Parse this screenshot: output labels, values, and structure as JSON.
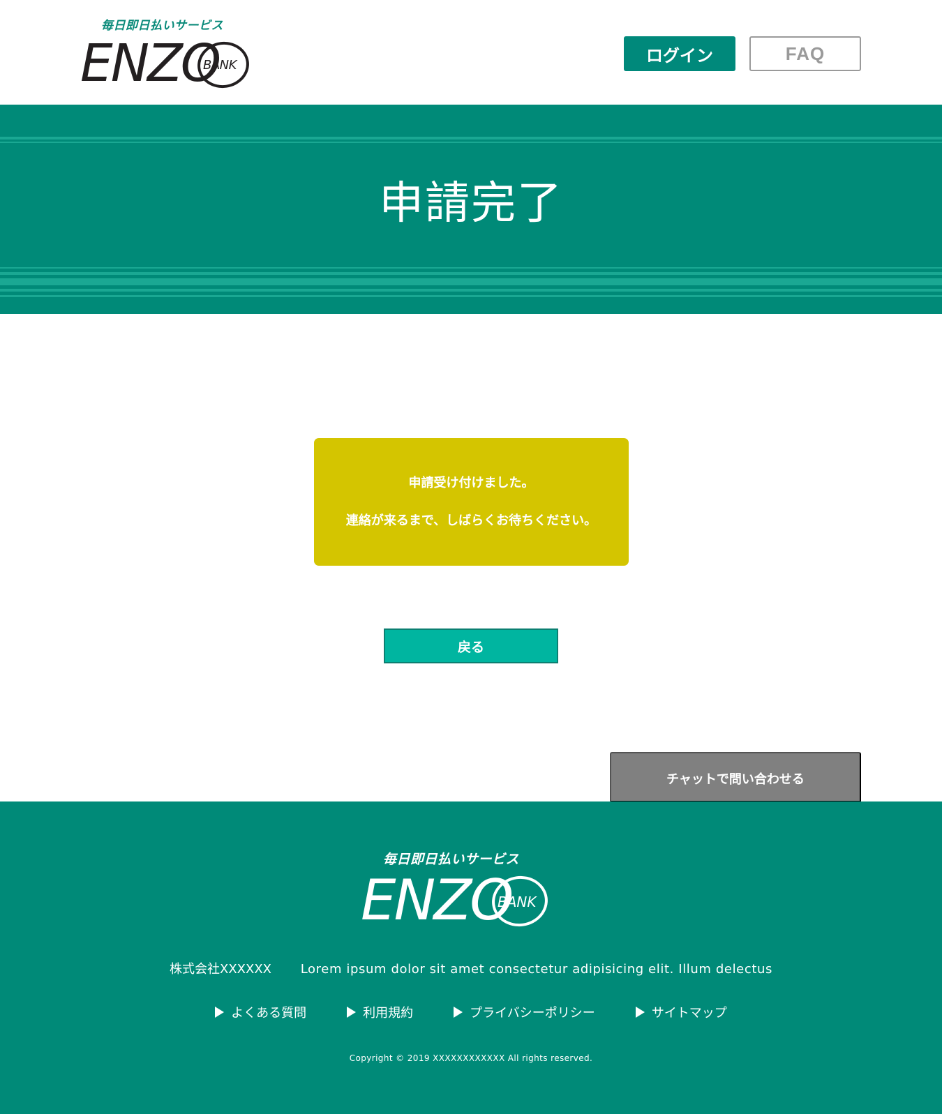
{
  "header": {
    "logo": {
      "tagline": "毎日即日払いサービス",
      "wordmark": "ENZO",
      "bank": "BANK"
    },
    "login_label": "ログイン",
    "faq_label": "FAQ"
  },
  "banner": {
    "title": "申請完了"
  },
  "notice": {
    "line1": "申請受け付けました。",
    "line2": "連絡が来るまで、しばらくお待ちください。"
  },
  "back_label": "戻る",
  "chat_label": "チャットで問い合わせる",
  "footer": {
    "logo": {
      "tagline": "毎日即日払いサービス",
      "wordmark": "ENZO",
      "bank": "BANK"
    },
    "company_name": "株式会社XXXXXX",
    "company_desc": "Lorem ipsum dolor sit amet consectetur adipisicing elit. Illum delectus",
    "links": [
      {
        "label": "よくある質問"
      },
      {
        "label": "利用規約"
      },
      {
        "label": "プライバシーポリシー"
      },
      {
        "label": "サイトマップ"
      }
    ],
    "copyright": "Copyright © 2019 XXXXXXXXXXXX All rights reserved."
  },
  "colors": {
    "brand_green": "#008a78",
    "banner_stripe": "#1aa893",
    "notice_yellow": "#d4c500",
    "back_button": "#00b5a0",
    "chat_button": "#808080"
  },
  "icons": {
    "footer_link_bullet": "play-triangle-icon"
  }
}
